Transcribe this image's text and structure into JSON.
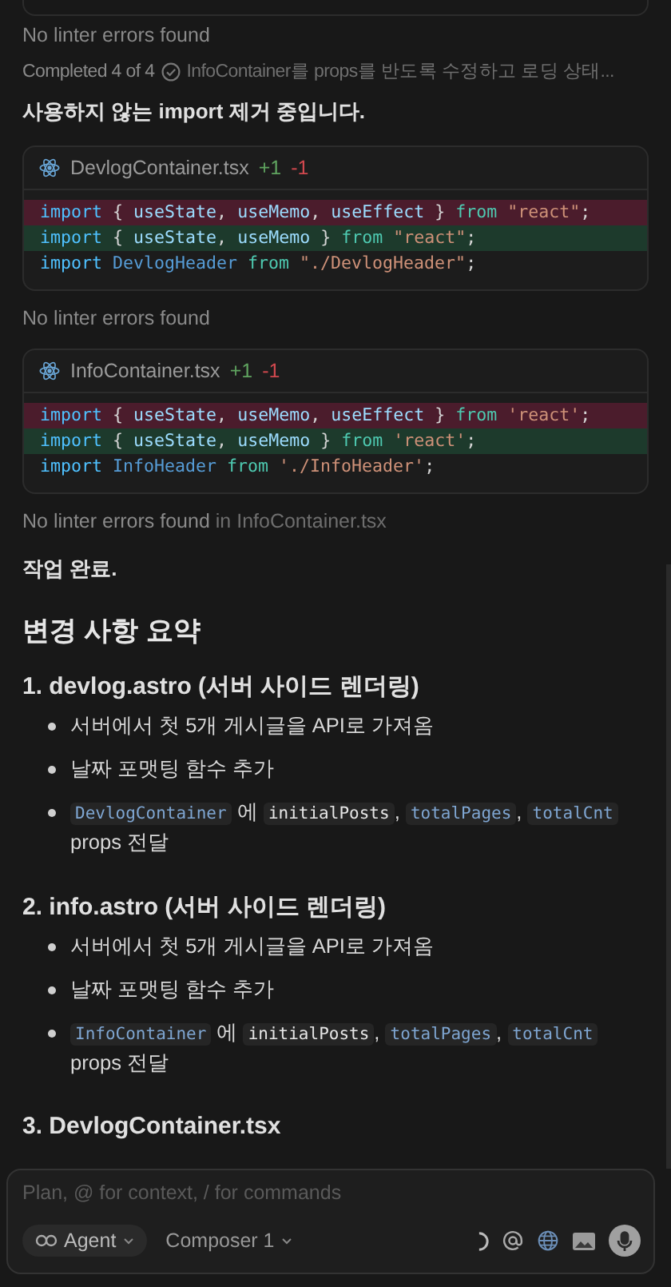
{
  "linter_status": "No linter errors found",
  "progress": {
    "label": "Completed 4 of 4",
    "done": true,
    "task": "InfoContainer를 props를 반도록 수정하고 로딩 상태..."
  },
  "message": "사용하지 않는 import 제거 중입니다.",
  "diffs": [
    {
      "file": "DevlogContainer.tsx",
      "added": "+1",
      "removed": "-1",
      "lines": [
        {
          "kind": "removed",
          "tokens": [
            {
              "text": "import",
              "kind": "keyword"
            },
            {
              "text": " { ",
              "kind": "punct"
            },
            {
              "text": "useState",
              "kind": "name"
            },
            {
              "text": ", ",
              "kind": "punct"
            },
            {
              "text": "useMemo",
              "kind": "name"
            },
            {
              "text": ", ",
              "kind": "punct"
            },
            {
              "text": "useEffect",
              "kind": "name"
            },
            {
              "text": " } ",
              "kind": "punct"
            },
            {
              "text": "from",
              "kind": "from"
            },
            {
              "text": " \"react\"",
              "kind": "string"
            },
            {
              "text": ";",
              "kind": "punct"
            }
          ]
        },
        {
          "kind": "added",
          "tokens": [
            {
              "text": "import",
              "kind": "keyword"
            },
            {
              "text": " { ",
              "kind": "punct"
            },
            {
              "text": "useState",
              "kind": "name"
            },
            {
              "text": ", ",
              "kind": "punct"
            },
            {
              "text": "useMemo",
              "kind": "name"
            },
            {
              "text": " } ",
              "kind": "punct"
            },
            {
              "text": "from",
              "kind": "from"
            },
            {
              "text": " \"react\"",
              "kind": "string"
            },
            {
              "text": ";",
              "kind": "punct"
            }
          ]
        },
        {
          "kind": "context",
          "tokens": [
            {
              "text": "import",
              "kind": "keyword"
            },
            {
              "text": " DevlogHeader",
              "kind": "type"
            },
            {
              "text": " from",
              "kind": "from"
            },
            {
              "text": " \"./DevlogHeader\"",
              "kind": "string"
            },
            {
              "text": ";",
              "kind": "punct"
            }
          ]
        }
      ],
      "status": "No linter errors found"
    },
    {
      "file": "InfoContainer.tsx",
      "added": "+1",
      "removed": "-1",
      "lines": [
        {
          "kind": "removed",
          "tokens": [
            {
              "text": "import",
              "kind": "keyword"
            },
            {
              "text": " { ",
              "kind": "punct"
            },
            {
              "text": "useState",
              "kind": "name"
            },
            {
              "text": ", ",
              "kind": "punct"
            },
            {
              "text": "useMemo",
              "kind": "name"
            },
            {
              "text": ", ",
              "kind": "punct"
            },
            {
              "text": "useEffect",
              "kind": "name"
            },
            {
              "text": " } ",
              "kind": "punct"
            },
            {
              "text": "from",
              "kind": "from"
            },
            {
              "text": " 'react'",
              "kind": "string"
            },
            {
              "text": ";",
              "kind": "punct"
            }
          ]
        },
        {
          "kind": "added",
          "tokens": [
            {
              "text": "import",
              "kind": "keyword"
            },
            {
              "text": " { ",
              "kind": "punct"
            },
            {
              "text": "useState",
              "kind": "name"
            },
            {
              "text": ", ",
              "kind": "punct"
            },
            {
              "text": "useMemo",
              "kind": "name"
            },
            {
              "text": " } ",
              "kind": "punct"
            },
            {
              "text": "from",
              "kind": "from"
            },
            {
              "text": " 'react'",
              "kind": "string"
            },
            {
              "text": ";",
              "kind": "punct"
            }
          ]
        },
        {
          "kind": "context",
          "tokens": [
            {
              "text": "import",
              "kind": "keyword"
            },
            {
              "text": " InfoHeader",
              "kind": "type"
            },
            {
              "text": " from",
              "kind": "from"
            },
            {
              "text": " './InfoHeader'",
              "kind": "string"
            },
            {
              "text": ";",
              "kind": "punct"
            }
          ]
        }
      ],
      "status": "No linter errors found",
      "status_suffix": "in InfoContainer.tsx"
    }
  ],
  "done_message": "작업 완료.",
  "summary": {
    "heading": "변경 사항 요약",
    "sections": [
      {
        "title": "1. devlog.astro (서버 사이드 렌더링)",
        "bullets": [
          [
            {
              "text": "서버에서 첫 5개 게시글을 API로 가져옴",
              "kind": "text"
            }
          ],
          [
            {
              "text": "날짜 포맷팅 함수 추가",
              "kind": "text"
            }
          ],
          [
            {
              "text": "DevlogContainer",
              "kind": "code-link"
            },
            {
              "text": " 에 ",
              "kind": "text"
            },
            {
              "text": "initialPosts",
              "kind": "code"
            },
            {
              "text": ", ",
              "kind": "text"
            },
            {
              "text": "totalPages",
              "kind": "code-link"
            },
            {
              "text": ", ",
              "kind": "text"
            },
            {
              "text": "totalCnt",
              "kind": "code-link"
            },
            {
              "text": " props 전달",
              "kind": "text"
            }
          ]
        ]
      },
      {
        "title": "2. info.astro (서버 사이드 렌더링)",
        "bullets": [
          [
            {
              "text": "서버에서 첫 5개 게시글을 API로 가져옴",
              "kind": "text"
            }
          ],
          [
            {
              "text": "날짜 포맷팅 함수 추가",
              "kind": "text"
            }
          ],
          [
            {
              "text": "InfoContainer",
              "kind": "code-link"
            },
            {
              "text": " 에 ",
              "kind": "text"
            },
            {
              "text": "initialPosts",
              "kind": "code"
            },
            {
              "text": ", ",
              "kind": "text"
            },
            {
              "text": "totalPages",
              "kind": "code-link"
            },
            {
              "text": ", ",
              "kind": "text"
            },
            {
              "text": "totalCnt",
              "kind": "code-link"
            },
            {
              "text": " props 전달",
              "kind": "text"
            }
          ]
        ]
      },
      {
        "title": "3. DevlogContainer.tsx"
      }
    ]
  },
  "composer": {
    "placeholder": "Plan, @ for context, / for commands",
    "mode": "Agent",
    "model": "Composer 1",
    "busy": true
  }
}
